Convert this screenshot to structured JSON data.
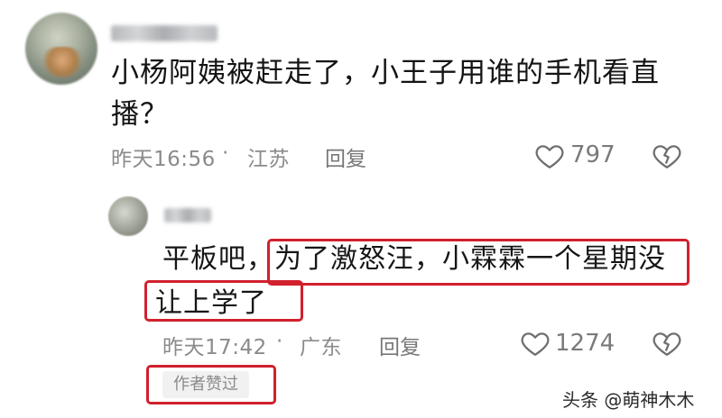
{
  "comment": {
    "text": "小杨阿姨被赶走了，小王子用谁的手机看直播？",
    "time": "昨天16:56",
    "separator": "·",
    "location": "江苏",
    "reply_label": "回复",
    "likes": "797"
  },
  "reply": {
    "prefix": "平板吧，",
    "highlight_line1": "为了激怒汪，小霖霖一个星期没",
    "highlight_line2": "让上学了",
    "time": "昨天17:42",
    "separator": "·",
    "location": "广东",
    "reply_label": "回复",
    "likes": "1274",
    "author_tag": "作者赞过"
  },
  "watermark": "头条 @萌神木木",
  "colors": {
    "highlight_border": "#d1202d",
    "meta_text": "#8b8b8b"
  },
  "icons": {
    "like": "heart-outline-icon",
    "dislike": "broken-heart-icon"
  }
}
